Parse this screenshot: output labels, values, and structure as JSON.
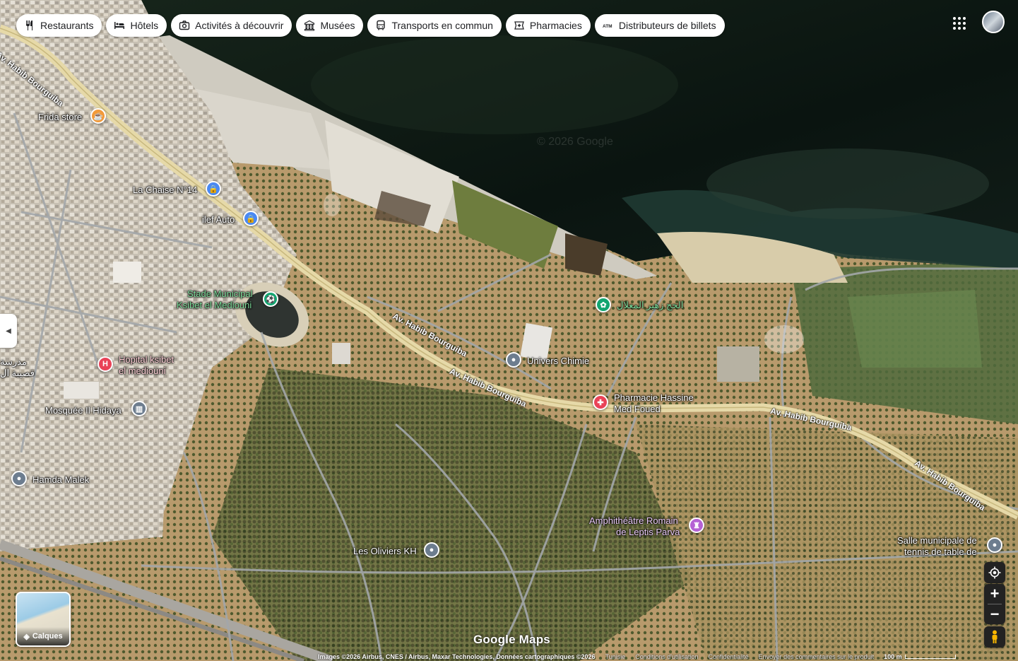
{
  "chips": [
    {
      "label": "Restaurants",
      "icon": "fork-knife-icon"
    },
    {
      "label": "Hôtels",
      "icon": "bed-icon"
    },
    {
      "label": "Activités à découvrir",
      "icon": "camera-icon"
    },
    {
      "label": "Musées",
      "icon": "museum-icon"
    },
    {
      "label": "Transports en commun",
      "icon": "bus-icon"
    },
    {
      "label": "Pharmacies",
      "icon": "pharmacy-icon"
    },
    {
      "label": "Distributeurs de billets",
      "icon": "atm-icon"
    }
  ],
  "roads": {
    "r1": "Av. Habib Bourguiba",
    "r2": "Av. Habib Bourguiba",
    "r3": "Av. Habib Bourguiba",
    "r4": "Av. Habib Bourguiba",
    "r5": "Av. Habib Bourguiba"
  },
  "pois": {
    "frida": "Frida store",
    "chaise": "La Chaise N°14",
    "ilef": "ilef Auto",
    "stade1": "Stade Municipal",
    "stade2": "Ksibet el Mediouni",
    "hajj": "الحج زهير المعلال",
    "univers": "Univers Chimie",
    "hopital1": "Hopital ksibet",
    "hopital2": "el mediouni",
    "madrasa1": "مدرسة",
    "madrasa2": "قصيبة ال",
    "pharmacie1": "Pharmacie Hassine",
    "pharmacie2": "Med Foued",
    "mosquee": "Mosquée Il Hidaya",
    "hamda": "Hamda Malek",
    "amphi1": "Amphithéâtre Romain",
    "amphi2": "de Leptis Parva",
    "oliviers": "Les Oliviers KH",
    "salle1": "Salle municipale de",
    "salle2": "tennis de table de"
  },
  "watermark": "© 2026 Google",
  "layers_label": "Calques",
  "brand": "Google Maps",
  "footer": {
    "imagery": "Images ©2026 Airbus, CNES / Airbus, Maxar Technologies, Données cartographiques ©2026",
    "country": "Tunisie",
    "terms": "Conditions d'utilisation",
    "privacy": "Confidentialité",
    "feedback": "Envoyer des commentaires sur le produit",
    "scale": "100 m"
  },
  "colors": {
    "sea": "#0f1a14",
    "road_main": "#e6d9a8",
    "road_minor": "#9aa0a4",
    "marker_red": "#e94257",
    "marker_blue": "#4a89f3",
    "marker_green": "#12a570",
    "marker_gray": "#6d7d8f",
    "marker_orange": "#f29a3a",
    "marker_purple": "#b562d4"
  }
}
